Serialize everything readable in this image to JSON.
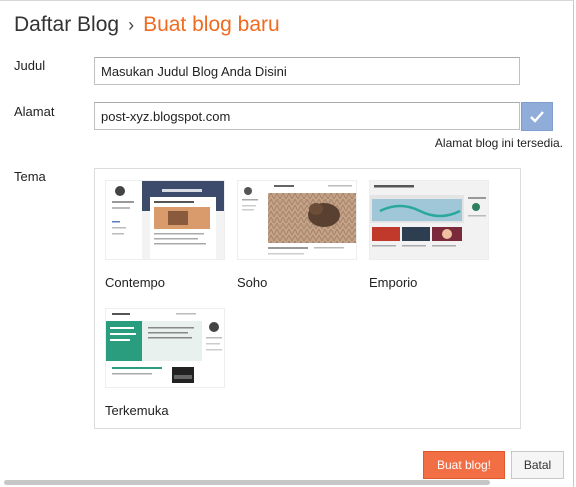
{
  "header": {
    "breadcrumb_root": "Daftar Blog",
    "separator": "›",
    "current": "Buat blog baru"
  },
  "form": {
    "title_label": "Judul",
    "title_value": "Masukan Judul Blog Anda Disini",
    "address_label": "Alamat",
    "address_value": "post-xyz.blogspot.com",
    "address_status": "Alamat blog ini tersedia.",
    "theme_label": "Tema"
  },
  "themes": [
    {
      "name": "Contempo"
    },
    {
      "name": "Soho"
    },
    {
      "name": "Emporio"
    },
    {
      "name": "Terkemuka"
    }
  ],
  "buttons": {
    "create": "Buat blog!",
    "cancel": "Batal"
  },
  "colors": {
    "accent": "#f06b1f",
    "primary_button": "#f26e45",
    "check_button": "#8fadd8"
  }
}
